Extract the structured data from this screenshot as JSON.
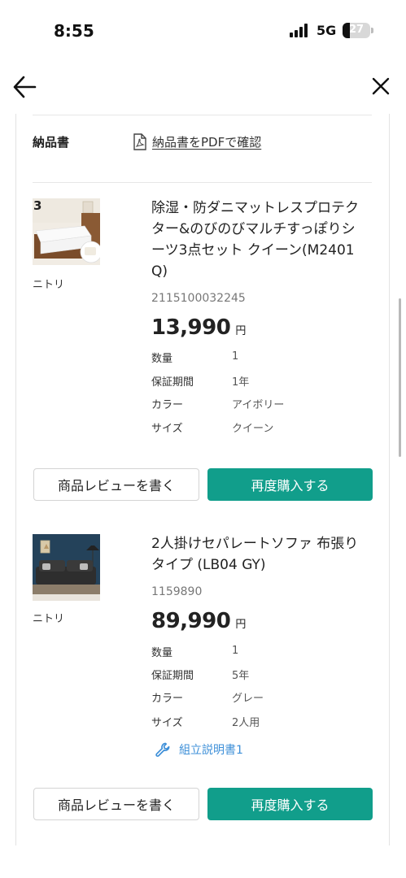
{
  "status_bar": {
    "time": "8:55",
    "network": "5G",
    "battery": "27",
    "battery_fraction": 0.27
  },
  "nav": {
    "back_icon": "arrow-left-icon",
    "close_icon": "close-icon"
  },
  "invoice": {
    "label": "納品書",
    "link_text": "納品書をPDFで確認",
    "icon": "pdf-file-icon"
  },
  "products": [
    {
      "vendor": "ニトリ",
      "title_lines": [
        "除湿・防ダニマットレスプロテク",
        "ター&のびのびマルチすっぽりシ",
        "ーツ3点セット クイーン(M2401",
        "Q)"
      ],
      "code": "2115100032245",
      "price": "13,990",
      "currency": "円",
      "specs": [
        {
          "label": "数量",
          "value": "1"
        },
        {
          "label": "保証期間",
          "value": "1年"
        },
        {
          "label": "カラー",
          "value": "アイボリー"
        },
        {
          "label": "サイズ",
          "value": "クイーン"
        }
      ],
      "image_badge": "3"
    },
    {
      "vendor": "ニトリ",
      "title_lines": [
        "2人掛けセパレートソファ 布張り",
        "タイプ (LB04 GY)"
      ],
      "code": "1159890",
      "price": "89,990",
      "currency": "円",
      "specs": [
        {
          "label": "数量",
          "value": "1"
        },
        {
          "label": "保証期間",
          "value": "5年"
        },
        {
          "label": "カラー",
          "value": "グレー"
        },
        {
          "label": "サイズ",
          "value": "2人用"
        }
      ],
      "manual_link": "組立説明書1",
      "manual_icon": "wrench-icon"
    }
  ],
  "buttons": {
    "review": "商品レビューを書く",
    "rebuy": "再度購入する"
  },
  "colors": {
    "accent": "#119e8b",
    "link": "#3d8fd8"
  }
}
